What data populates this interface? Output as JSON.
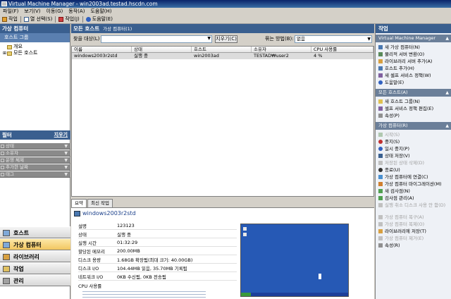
{
  "window": {
    "title": "Virtual Machine Manager - win2003ad.testad.hscdn.com"
  },
  "menu": [
    "파일(F)",
    "보기(V)",
    "이동(G)",
    "동작(A)",
    "도움말(H)"
  ],
  "toolbar": [
    {
      "label": "작업",
      "icon": "jobs-icon"
    },
    {
      "label": "열 선택(S)",
      "icon": "columns-icon"
    },
    {
      "label": "작업(J)",
      "icon": "tasks-icon"
    },
    {
      "label": "도움말(E)",
      "icon": "help-icon"
    }
  ],
  "left": {
    "header": "가상 컴퓨터",
    "group_header": "호스트 그룹",
    "tree": [
      "개요",
      "모든 호스트"
    ],
    "filter_header": "필터",
    "filter_clear": "지우기",
    "filters": [
      "상태",
      "소유자",
      "운영 체제",
      "추가한 날짜",
      "태그"
    ],
    "nav": [
      "호스트",
      "가상 컴퓨터",
      "라이브러리",
      "작업",
      "관리"
    ]
  },
  "center": {
    "header": "모든 호스트",
    "subheader": "가상 컴퓨터(1)",
    "search_label": "찾을 대상(L)",
    "search_value": "",
    "clear_button": "지우기(C)",
    "group_label": "묶는 방법(B):",
    "group_value": "없음",
    "columns": [
      "이름",
      "상태",
      "호스트",
      "소유자",
      "CPU 사용률"
    ],
    "rows": [
      [
        "windows2003r2std",
        "실행 중",
        "win2003ad",
        "TESTAD₩user2",
        "4 %"
      ]
    ],
    "tabs": [
      "요약",
      "최신 작업"
    ],
    "vm_name": "windows2003r2std",
    "details": [
      [
        "설명",
        "123123"
      ],
      [
        "상태",
        "실행 중"
      ],
      [
        "실행 시간",
        "01:32:29"
      ],
      [
        "할당된 메모리",
        "200.00MB"
      ],
      [
        "디스크 용량",
        "1.68GB 확장됨(최대 크기: 40.00GB)"
      ],
      [
        "디스크 I/O",
        "104.44MB 읽음, 35.70MB 기록됨"
      ],
      [
        "네트워크 I/O",
        "0KB 수신됨, 0KB 전송됨"
      ],
      [
        "CPU 사용률",
        ""
      ]
    ]
  },
  "right": {
    "header": "작업",
    "sections": [
      {
        "title": "Virtual Machine Manager",
        "items": [
          {
            "label": "새 가상 컴퓨터(N)",
            "icon": "new-vm-icon",
            "enabled": true
          },
          {
            "label": "물리적 서버 변환(O)",
            "icon": "convert-icon",
            "enabled": true
          },
          {
            "label": "라이브러리 서버 추가(A)",
            "icon": "library-icon",
            "enabled": true
          },
          {
            "label": "호스트 추가(H)",
            "icon": "add-host-icon",
            "enabled": true
          },
          {
            "label": "새 셀프 서비스 정책(W)",
            "icon": "policy-icon",
            "enabled": true
          },
          {
            "label": "도움말(E)",
            "icon": "help-icon",
            "enabled": true
          }
        ]
      },
      {
        "title": "모든 호스트(A)",
        "items": [
          {
            "label": "새 호스트 그룹(N)",
            "icon": "folder-icon",
            "enabled": true
          },
          {
            "label": "셀프 서비스 정책 편집(E)",
            "icon": "policy-icon",
            "enabled": true
          },
          {
            "label": "속성(P)",
            "icon": "properties-icon",
            "enabled": true
          }
        ]
      },
      {
        "title": "가상 컴퓨터(R)",
        "items": [
          {
            "label": "시작(S)",
            "icon": "start-icon",
            "enabled": false
          },
          {
            "label": "중지(S)",
            "icon": "stop-icon",
            "enabled": true
          },
          {
            "label": "일시 중지(P)",
            "icon": "pause-icon",
            "enabled": true
          },
          {
            "label": "상태 저장(V)",
            "icon": "save-state-icon",
            "enabled": true
          },
          {
            "label": "저장된 상태 삭제(D)",
            "icon": "discard-icon",
            "enabled": false
          },
          {
            "label": "종료(U)",
            "icon": "shutdown-icon",
            "enabled": true
          },
          {
            "label": "가상 컴퓨터에 연결(C)",
            "icon": "connect-icon",
            "enabled": true
          },
          {
            "label": "가상 컴퓨터 마이그레이션(M)",
            "icon": "migrate-icon",
            "enabled": true
          },
          {
            "label": "새 검사점(N)",
            "icon": "checkpoint-icon",
            "enabled": true
          },
          {
            "label": "검사점 관리(A)",
            "icon": "checkpoint-manage-icon",
            "enabled": true
          },
          {
            "label": "실행 취소 디스크 사용 안 함(D)",
            "icon": "undo-disk-icon",
            "enabled": false
          },
          {
            "label": "가상 컴퓨터 복구(A)",
            "icon": "repair-icon",
            "enabled": false
          },
          {
            "label": "가상 컴퓨터 복제(O)",
            "icon": "clone-icon",
            "enabled": false
          },
          {
            "label": "라이브러리에 저장(T)",
            "icon": "store-icon",
            "enabled": true
          },
          {
            "label": "가상 컴퓨터 제거(E)",
            "icon": "delete-icon",
            "enabled": false
          },
          {
            "label": "속성(R)",
            "icon": "properties-icon",
            "enabled": true
          }
        ]
      }
    ]
  },
  "colors": {
    "pane_header": "#3a5f8f",
    "title_bar": "#0a246a",
    "nav_selected": "#f2c760",
    "desktop": "#2659b5"
  }
}
